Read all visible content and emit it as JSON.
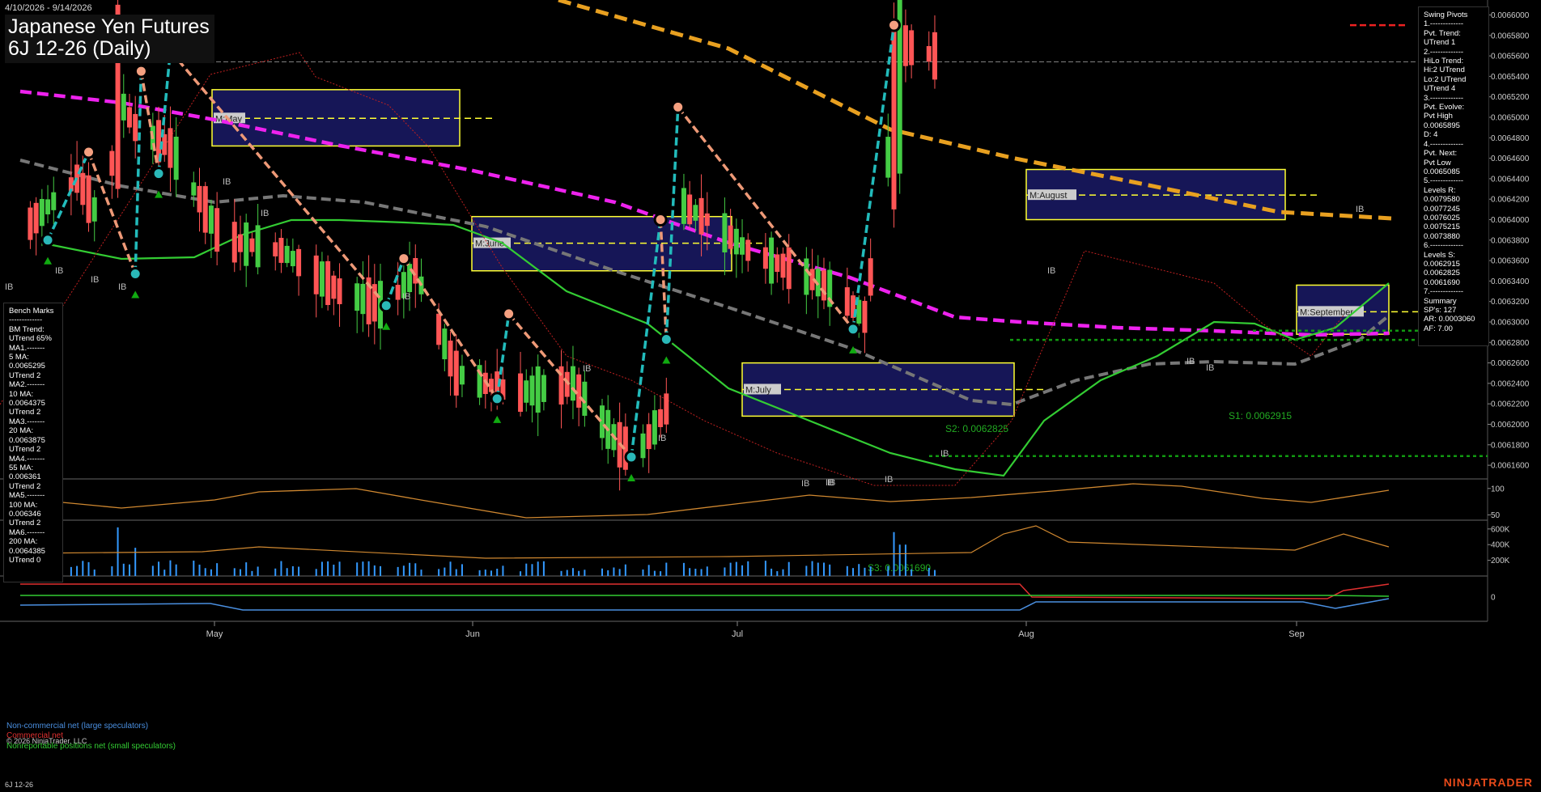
{
  "header": {
    "date_range": "4/10/2026 - 9/14/2026",
    "title_line1": "Japanese Yen Futures",
    "title_line2": "6J 12-26 (Daily)"
  },
  "footer": {
    "instrument": "6J 12-26",
    "copyright": "© 2026 NinjaTrader, LLC",
    "brand": "NINJATRADER"
  },
  "swing_pivots_panel": [
    "Swing Pivots",
    "1.-------------",
    "Pvt. Trend:",
    "UTrend 1",
    "2.-------------",
    "HiLo Trend:",
    "Hi:2 UTrend",
    "Lo:2 UTrend",
    "UTrend 4",
    "3.-------------",
    "Pvt. Evolve:",
    "Pvt High",
    "0.0065895",
    "D: 4",
    "4.-------------",
    "Pvt. Next:",
    "Pvt Low",
    "0.0065085",
    "5.-------------",
    "Levels R:",
    "0.0079580",
    "0.0077245",
    "0.0076025",
    "0.0075215",
    "0.0073880",
    "6.-------------",
    "Levels S:",
    "0.0062915",
    "0.0062825",
    "0.0061690",
    "7.-------------",
    "Summary",
    "SP's: 127",
    "AR: 0.0003060",
    "AF: 7.00"
  ],
  "benchmarks_panel": [
    "Bench Marks",
    "-------------",
    "BM Trend:",
    "UTrend 65%",
    "MA1.-------",
    "5 MA:",
    "0.0065295",
    "UTrend 2",
    "MA2.-------",
    "10 MA:",
    "0.0064375",
    "UTrend 2",
    "MA3.-------",
    "20 MA:",
    "0.0063875",
    "UTrend 2",
    "MA4.-------",
    "55 MA:",
    "0.006361",
    "UTrend 2",
    "MA5.-------",
    "100 MA:",
    "0.006346",
    "UTrend 2",
    "MA6.-------",
    "200 MA:",
    "0.0064385",
    "UTrend 0"
  ],
  "cot_legend": {
    "noncommercial": "Non-commercial net (large speculators)",
    "commercial": "Commercial net",
    "nonreportable": "Nonreportable positions net (small speculators)"
  },
  "colors": {
    "background": "#000000",
    "up_candle": "#44cc44",
    "down_candle": "#ff5555",
    "ma_green": "#33cc33",
    "ma_gray": "#777777",
    "ma_magenta": "#ee22ee",
    "ma_orange": "#e8a020",
    "swing_up": "#22bbbb",
    "swing_down": "#ee9977",
    "box_fill": "#1a1a66",
    "box_border": "#ffff33",
    "support": "#119911",
    "volume": "#3399ff",
    "accent_brand": "#e84a1a"
  },
  "chart_data": [
    {
      "type": "candlestick",
      "panel": "price",
      "ylim": [
        0.00615,
        0.00661
      ],
      "y_tick_labels": [
        "0.0066000",
        "0.0065800",
        "0.0065600",
        "0.0065400",
        "0.0065200",
        "0.0065000",
        "0.0064800",
        "0.0064600",
        "0.0064400",
        "0.0064200",
        "0.0064000",
        "0.0063800",
        "0.0063600",
        "0.0063400",
        "0.0063200",
        "0.0063000",
        "0.0062800",
        "0.0062600",
        "0.0062400",
        "0.0062200",
        "0.0062000",
        "0.0061800",
        "0.0061600"
      ],
      "x_month_labels": [
        "May",
        "Jun",
        "Jul",
        "Aug",
        "Sep"
      ],
      "current_price": 0.006555,
      "month_boxes": [
        {
          "label": "M:May",
          "high": 0.006527,
          "low": 0.006472,
          "mid": 0.006499
        },
        {
          "label": "M:June",
          "high": 0.006403,
          "low": 0.00635,
          "mid": 0.006377
        },
        {
          "label": "M:July",
          "high": 0.00626,
          "low": 0.006208,
          "mid": 0.006234
        },
        {
          "label": "M:August",
          "high": 0.006449,
          "low": 0.0064,
          "mid": 0.006424
        },
        {
          "label": "M:September",
          "high": 0.006336,
          "low": 0.006288,
          "mid": 0.00631
        }
      ],
      "level_labels": [
        {
          "label": "S2: 0.0062825",
          "value": 0.0062825
        },
        {
          "label": "S1: 0.0062915",
          "value": 0.0062915
        },
        {
          "label": "S3: 0.0061690",
          "value": 0.006169
        }
      ],
      "ib_labels": [
        "IB",
        "IB",
        "IB",
        "IB",
        "IB",
        "IB",
        "IB",
        "IB",
        "IB",
        "IB",
        "IB",
        "IB",
        "IB",
        "IB",
        "IB",
        "IB",
        "IB",
        "IB"
      ],
      "swing_points": [
        {
          "date": "Apr 15",
          "value": 0.00638,
          "kind": "low"
        },
        {
          "date": "Apr 22",
          "value": 0.006466,
          "kind": "high"
        },
        {
          "date": "Apr 30",
          "value": 0.006347,
          "kind": "low"
        },
        {
          "date": "May 1",
          "value": 0.006545,
          "kind": "high"
        },
        {
          "date": "May 4",
          "value": 0.006445,
          "kind": "low"
        },
        {
          "date": "May 6",
          "value": 0.006565,
          "kind": "high"
        },
        {
          "date": "Jun 12",
          "value": 0.006316,
          "kind": "low"
        },
        {
          "date": "Jun 15",
          "value": 0.006362,
          "kind": "high"
        },
        {
          "date": "Jul 1",
          "value": 0.006225,
          "kind": "low"
        },
        {
          "date": "Jul 3",
          "value": 0.006308,
          "kind": "high"
        },
        {
          "date": "Jul 24",
          "value": 0.006168,
          "kind": "low"
        },
        {
          "date": "Jul 29",
          "value": 0.0064,
          "kind": "high"
        },
        {
          "date": "Jul 30",
          "value": 0.006283,
          "kind": "low"
        },
        {
          "date": "Aug 1",
          "value": 0.00651,
          "kind": "high"
        },
        {
          "date": "Aug 31",
          "value": 0.006293,
          "kind": "low"
        },
        {
          "date": "Sep 7",
          "value": 0.00659,
          "kind": "high"
        }
      ],
      "moving_averages": {
        "MA5": 0.0065295,
        "MA10": 0.0064375,
        "MA20": 0.0063875,
        "MA55": 0.006361,
        "MA100": 0.006346,
        "MA200": 0.0064385
      }
    },
    {
      "type": "line",
      "panel": "oscillator",
      "y_tick_labels": [
        "100",
        "50"
      ],
      "ylim": [
        40,
        115
      ]
    },
    {
      "type": "bar",
      "panel": "volume",
      "y_tick_labels": [
        "600K",
        "400K",
        "200K"
      ],
      "ylim": [
        0,
        650000
      ]
    },
    {
      "type": "line",
      "panel": "cot",
      "y_tick_labels": [
        "0"
      ],
      "series": [
        {
          "name": "Non-commercial net (large speculators)"
        },
        {
          "name": "Commercial net"
        },
        {
          "name": "Nonreportable positions net (small speculators)"
        }
      ]
    }
  ]
}
